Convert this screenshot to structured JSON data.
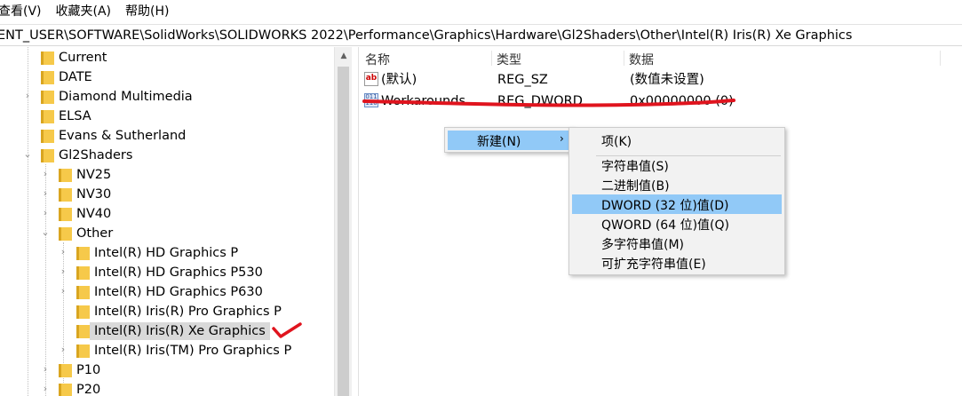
{
  "menubar": {
    "items": [
      "查看(V)",
      "收藏夹(A)",
      "帮助(H)"
    ]
  },
  "address": {
    "path": "ENT_USER\\SOFTWARE\\SolidWorks\\SOLIDWORKS 2022\\Performance\\Graphics\\Hardware\\Gl2Shaders\\Other\\Intel(R) Iris(R) Xe Graphics"
  },
  "tree": {
    "items": [
      {
        "label": "Current"
      },
      {
        "label": "DATE"
      },
      {
        "label": "Diamond Multimedia"
      },
      {
        "label": "ELSA"
      },
      {
        "label": "Evans & Sutherland"
      },
      {
        "label": "Gl2Shaders"
      },
      {
        "label": "NV25"
      },
      {
        "label": "NV30"
      },
      {
        "label": "NV40"
      },
      {
        "label": "Other"
      },
      {
        "label": "Intel(R) HD Graphics P"
      },
      {
        "label": "Intel(R) HD Graphics P530"
      },
      {
        "label": "Intel(R) HD Graphics P630"
      },
      {
        "label": "Intel(R) Iris(R) Pro Graphics P"
      },
      {
        "label": "Intel(R) Iris(R) Xe Graphics"
      },
      {
        "label": "Intel(R) Iris(TM) Pro Graphics P"
      },
      {
        "label": "P10"
      },
      {
        "label": "P20"
      }
    ],
    "selected": "Intel(R) Iris(R) Xe Graphics"
  },
  "list": {
    "columns": {
      "name": "名称",
      "type": "类型",
      "data": "数据"
    },
    "rows": [
      {
        "name": "(默认)",
        "type": "REG_SZ",
        "data": "(数值未设置)",
        "icon": "string-value-icon"
      },
      {
        "name": "Workarounds",
        "type": "REG_DWORD",
        "data": "0x00000000 (0)",
        "icon": "binary-value-icon"
      }
    ]
  },
  "context_menu": {
    "new_label": "新建(N)",
    "arrow": "›",
    "submenu": [
      "项(K)",
      "字符串值(S)",
      "二进制值(B)",
      "DWORD (32 位)值(D)",
      "QWORD (64 位)值(Q)",
      "多字符串值(M)",
      "可扩充字符串值(E)"
    ],
    "highlighted": "DWORD (32 位)值(D)"
  },
  "colors": {
    "highlight": "#91c9f7",
    "annotation_red": "#e0141e",
    "folder": "#f6c94a"
  }
}
